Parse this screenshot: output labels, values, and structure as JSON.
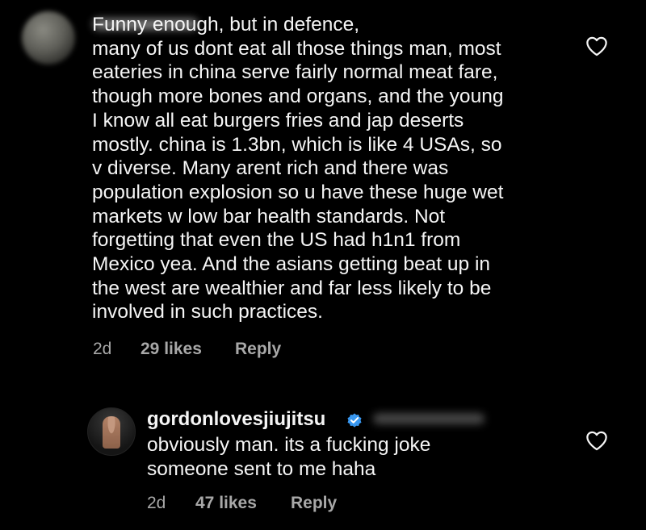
{
  "comments": [
    {
      "text": "Funny enough, but in defence,\nmany of us dont eat all those things man, most\neateries in china serve fairly normal meat fare,\nthough more bones and organs, and the young\nI know all eat burgers fries and jap deserts\nmostly. china is 1.3bn, which is like 4 USAs, so\nv diverse. Many arent rich and there was\npopulation explosion so u have these huge wet\nmarkets w low bar health standards. Not\nforgetting that even the US had h1n1 from\nMexico yea. And the asians getting beat up in\nthe west are wealthier and far less likely to be\ninvolved in such practices.",
      "time": "2d",
      "likes": "29 likes",
      "reply": "Reply"
    },
    {
      "username": "gordonlovesjiujitsu",
      "text": "obviously man. its a fucking joke\nsomeone sent to me haha",
      "time": "2d",
      "likes": "47 likes",
      "reply": "Reply"
    }
  ],
  "icons": {
    "like": "heart-outline-icon",
    "verified": "verified-badge-icon"
  },
  "colors": {
    "background": "#000000",
    "text": "#f5f5f5",
    "meta": "#a8a8a8",
    "verified": "#3897f0"
  }
}
